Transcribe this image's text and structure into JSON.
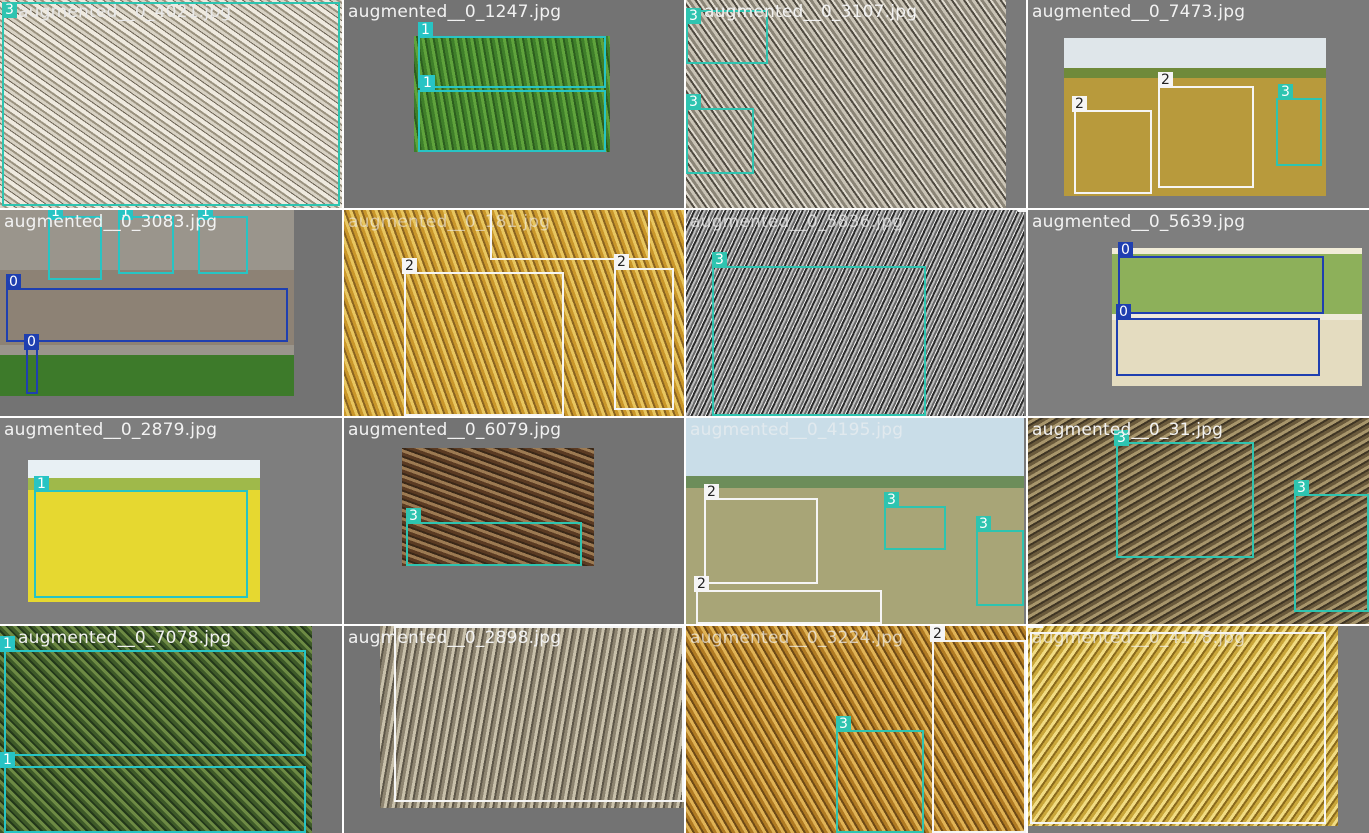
{
  "colors": {
    "class0": "#1f3fb0",
    "class1": "#27c4c4",
    "class2": "#f5f5f5",
    "class3": "#2ec4b0"
  },
  "tiles": [
    {
      "filename": "augmented__0_4021.jpg",
      "labels": [
        "3"
      ]
    },
    {
      "filename": "augmented__0_1247.jpg",
      "labels": [
        "1",
        "1"
      ]
    },
    {
      "filename": "augmented__0_3107.jpg",
      "labels": [
        "3",
        "3"
      ]
    },
    {
      "filename": "augmented__0_7473.jpg",
      "labels": [
        "2",
        "2",
        "3"
      ]
    },
    {
      "filename": "augmented__0_3083.jpg",
      "labels": [
        "1",
        "1",
        "1",
        "0",
        "0"
      ]
    },
    {
      "filename": "augmented__0_181.jpg",
      "labels": [
        "2",
        "2",
        "2"
      ]
    },
    {
      "filename": "augmented__0_5836.jpg",
      "labels": [
        "3",
        "2"
      ]
    },
    {
      "filename": "augmented__0_5639.jpg",
      "labels": [
        "0",
        "0"
      ]
    },
    {
      "filename": "augmented__0_2879.jpg",
      "labels": [
        "1"
      ]
    },
    {
      "filename": "augmented__0_6079.jpg",
      "labels": [
        "3"
      ]
    },
    {
      "filename": "augmented__0_4195.jpg",
      "labels": [
        "2",
        "3",
        "3",
        "2"
      ]
    },
    {
      "filename": "augmented__0_31.jpg",
      "labels": [
        "3",
        "3"
      ]
    },
    {
      "filename": "augmented__0_7078.jpg",
      "labels": [
        "1",
        "1"
      ]
    },
    {
      "filename": "augmented__0_2898.jpg",
      "labels": [
        "2"
      ]
    },
    {
      "filename": "augmented__0_3224.jpg",
      "labels": [
        "2",
        "3"
      ]
    },
    {
      "filename": "augmented__0_4178.jpg",
      "labels": [
        "2"
      ]
    }
  ]
}
